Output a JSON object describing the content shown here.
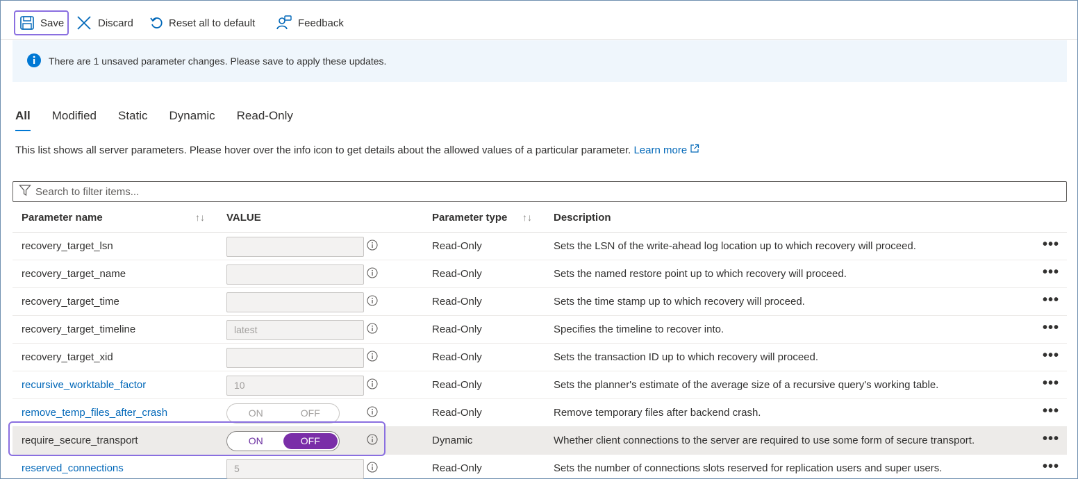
{
  "toolbar": {
    "save_label": "Save",
    "discard_label": "Discard",
    "reset_label": "Reset all to default",
    "feedback_label": "Feedback"
  },
  "banner": {
    "message": "There are 1 unsaved parameter changes.  Please save to apply these updates."
  },
  "tabs": [
    {
      "label": "All",
      "active": true
    },
    {
      "label": "Modified"
    },
    {
      "label": "Static"
    },
    {
      "label": "Dynamic"
    },
    {
      "label": "Read-Only"
    }
  ],
  "description": {
    "text": "This list shows all server parameters. Please hover over the info icon to get details about the allowed values of a particular parameter.",
    "learn_more": "Learn more"
  },
  "search": {
    "placeholder": "Search to filter items..."
  },
  "table": {
    "headers": {
      "name": "Parameter name",
      "value": "VALUE",
      "type": "Parameter type",
      "description": "Description"
    },
    "sort_glyph": "↑↓",
    "more_glyph": "•••",
    "toggle": {
      "on": "ON",
      "off": "OFF"
    },
    "rows": [
      {
        "name": "recovery_target_lsn",
        "value": "",
        "type": "Read-Only",
        "description": "Sets the LSN of the write-ahead log location up to which recovery will proceed."
      },
      {
        "name": "recovery_target_name",
        "value": "",
        "type": "Read-Only",
        "description": "Sets the named restore point up to which recovery will proceed."
      },
      {
        "name": "recovery_target_time",
        "value": "",
        "type": "Read-Only",
        "description": "Sets the time stamp up to which recovery will proceed."
      },
      {
        "name": "recovery_target_timeline",
        "value": "latest",
        "type": "Read-Only",
        "description": "Specifies the timeline to recover into."
      },
      {
        "name": "recovery_target_xid",
        "value": "",
        "type": "Read-Only",
        "description": "Sets the transaction ID up to which recovery will proceed."
      },
      {
        "name": "recursive_worktable_factor",
        "value": "10",
        "type": "Read-Only",
        "description": "Sets the planner's estimate of the average size of a recursive query's working table."
      },
      {
        "name": "remove_temp_files_after_crash",
        "value": "",
        "type": "Read-Only",
        "description": "Remove temporary files after backend crash."
      },
      {
        "name": "require_secure_transport",
        "value": "OFF",
        "type": "Dynamic",
        "description": "Whether client connections to the server are required to use some form of secure transport."
      },
      {
        "name": "reserved_connections",
        "value": "5",
        "type": "Read-Only",
        "description": "Sets the number of connections slots reserved for replication users and super users."
      }
    ]
  },
  "colors": {
    "accent": "#0078d4",
    "link": "#0067b8",
    "toggle_on": "#7a2ea8",
    "focus_outline": "#8a6fe0",
    "banner_bg": "#eff6fc"
  }
}
